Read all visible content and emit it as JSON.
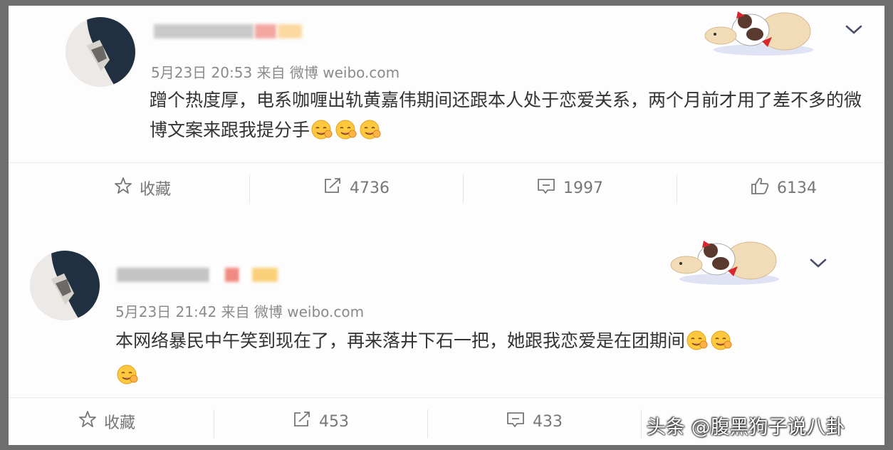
{
  "posts": [
    {
      "meta": "5月23日 20:53 来自 微博 weibo.com",
      "content": "蹭个热度厚，电系咖喱出轨黄嘉伟期间还跟本人处于恋爱关系，两个月前才用了差不多的微博文案来跟我提分手",
      "emoji_count": 3,
      "actions": {
        "favorite_label": "收藏",
        "repost_count": "4736",
        "comment_count": "1997",
        "like_count": "6134"
      }
    },
    {
      "meta": "5月23日 21:42 来自 微博 weibo.com",
      "content": "本网络暴民中午笑到现在了，再来落井下石一把，她跟我恋爱是在团期间",
      "emoji_count": 3,
      "actions": {
        "favorite_label": "收藏",
        "repost_count": "453",
        "comment_count": "433",
        "like_count": ""
      }
    }
  ],
  "watermark": "头条 @腹黑狗子说八卦",
  "colors": {
    "background": "#fdfdfd",
    "text": "#333333",
    "meta": "#8a8a8a",
    "icon": "#777777"
  }
}
